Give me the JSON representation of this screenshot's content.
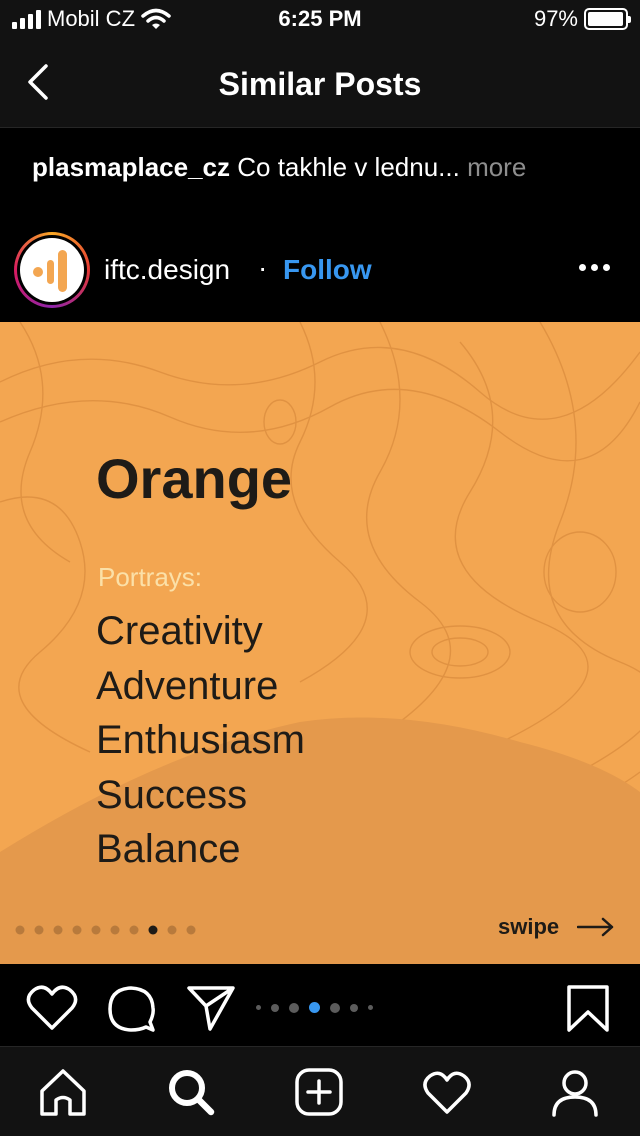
{
  "status_bar": {
    "carrier": "Mobil CZ",
    "time": "6:25 PM",
    "battery_text": "97%",
    "battery_level": 0.97
  },
  "nav": {
    "title": "Similar Posts"
  },
  "caption": {
    "username": "plasmaplace_cz",
    "text": "Co takhle v lednu...",
    "more_label": "more"
  },
  "post": {
    "username": "iftc.design",
    "separator": "·",
    "follow_label": "Follow",
    "image": {
      "heading": "Orange",
      "subheading": "Portrays:",
      "items": [
        "Creativity",
        "Adventure",
        "Enthusiasm",
        "Success",
        "Balance"
      ],
      "swipe_label": "swipe",
      "page_count": 10,
      "current_page": 8,
      "background_color": "#f3a651"
    },
    "carousel": {
      "count": 7,
      "active_index": 4
    }
  },
  "tabbar": {
    "items": [
      "home-icon",
      "search-icon",
      "add-post-icon",
      "activity-icon",
      "profile-icon"
    ]
  },
  "colors": {
    "accent": "#3897f0",
    "background": "#000000",
    "muted": "#8e8e8e"
  }
}
